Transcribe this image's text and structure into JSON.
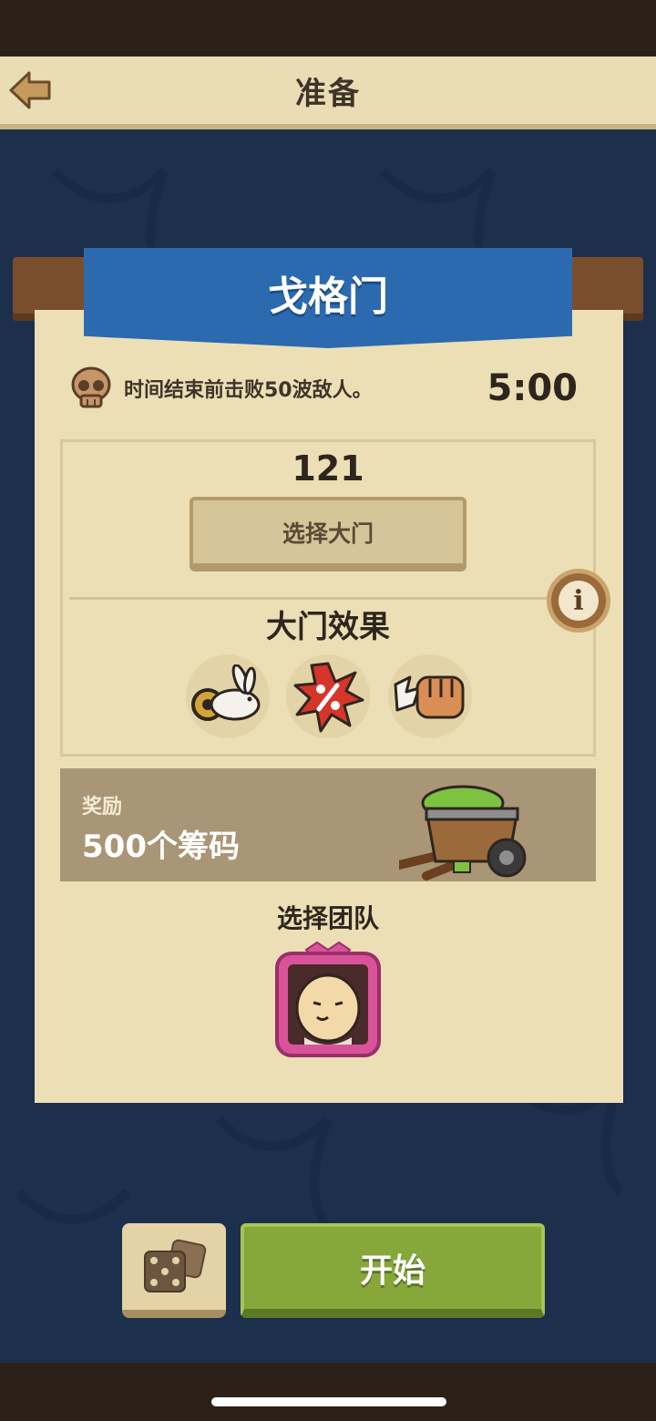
{
  "header": {
    "title": "准备",
    "back_icon": "arrow-left-icon"
  },
  "level": {
    "name": "戈格门",
    "objective": "时间结束前击败50波敌人。",
    "timer": "5:00"
  },
  "gate": {
    "number": "121",
    "select_label": "选择大门",
    "effects_title": "大门效果",
    "effects": [
      "rabbit-speed-icon",
      "percent-burst-icon",
      "fist-icon"
    ],
    "info_icon": "info-icon"
  },
  "reward": {
    "label": "奖励",
    "value": "500个筹码",
    "icon": "mine-cart-icon"
  },
  "team": {
    "title": "选择团队",
    "hero_icon": "hero-portrait-icon"
  },
  "actions": {
    "start_label": "开始",
    "dice_icon": "dice-icon"
  },
  "colors": {
    "banner": "#2c6aaf",
    "start_button": "#86a73a",
    "paper": "#ecdfb6",
    "background": "#1c2f4c",
    "portrait_frame": "#d9539a"
  }
}
